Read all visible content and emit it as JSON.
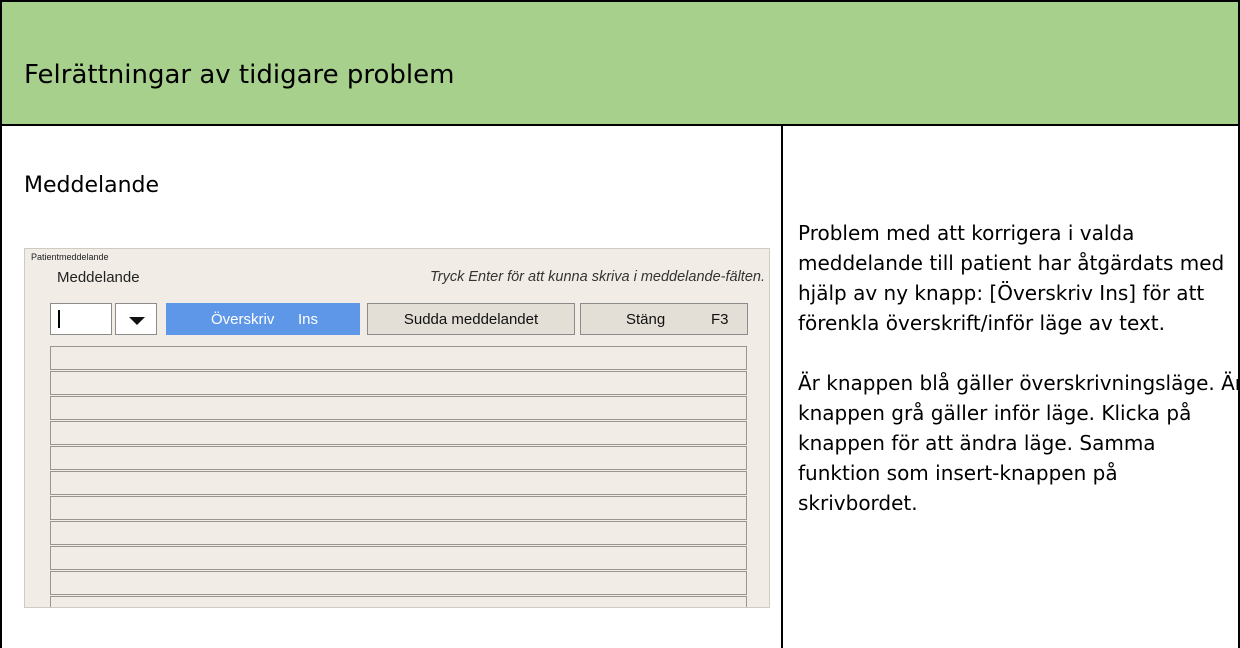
{
  "header": {
    "title": "Felrättningar av tidigare problem"
  },
  "left": {
    "heading": "Meddelande",
    "screenshot": {
      "window_title": "Patientmeddelande",
      "label": "Meddelande",
      "hint": "Tryck Enter för att kunna skriva i meddelande-fälten.",
      "overwrite_label": "Överskriv",
      "overwrite_key": "Ins",
      "erase_label": "Sudda meddelandet",
      "close_label": "Stäng",
      "close_key": "F3",
      "colors": {
        "overwrite_active": "#5f97e8",
        "window_bg": "#f1ede6"
      },
      "icons": {
        "dropdown": "chevron-down-icon"
      }
    }
  },
  "right": {
    "paragraph1": "Problem med att korrigera i valda meddelande till patient har åtgärdats med hjälp av ny knapp: [Överskriv Ins] för att förenkla överskrift/inför läge av text.",
    "paragraph2": "Är knappen blå gäller överskrivningsläge. Är knappen grå gäller inför läge. Klicka på knappen för att ändra läge. Samma funktion som insert-knappen på skrivbordet."
  },
  "colors": {
    "header_bg": "#a8d08d"
  }
}
